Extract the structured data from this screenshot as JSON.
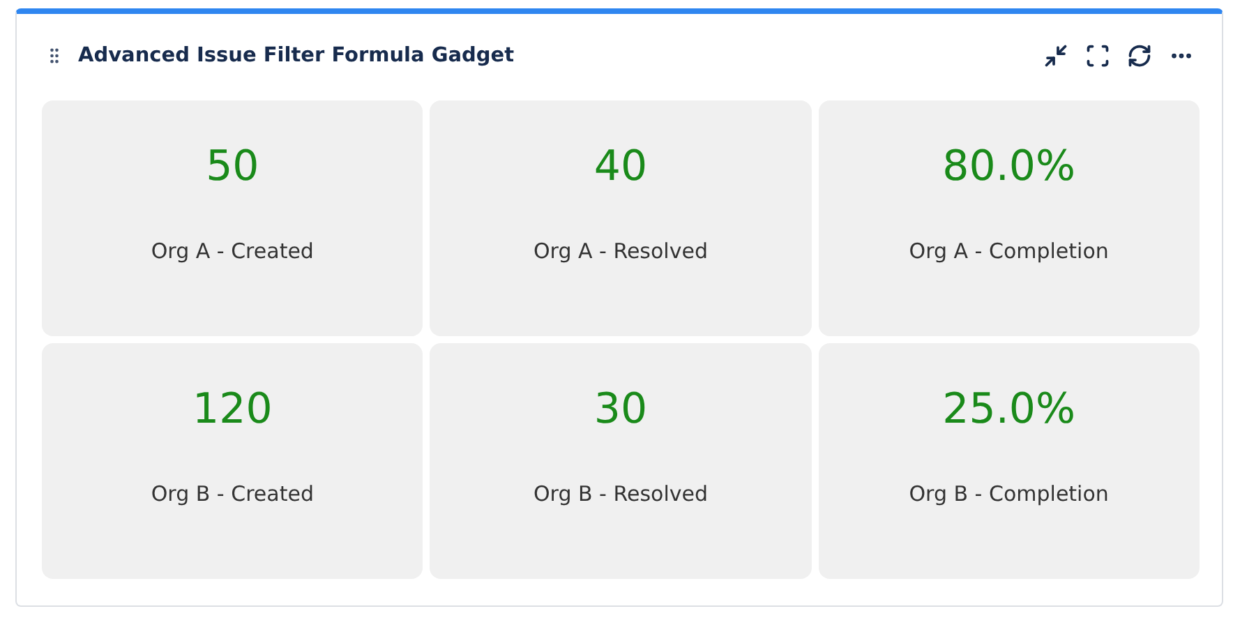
{
  "gadget": {
    "title": "Advanced Issue Filter Formula Gadget"
  },
  "tiles": [
    {
      "value": "50",
      "label": "Org A - Created"
    },
    {
      "value": "40",
      "label": "Org A - Resolved"
    },
    {
      "value": "80.0%",
      "label": "Org A - Completion"
    },
    {
      "value": "120",
      "label": "Org B - Created"
    },
    {
      "value": "30",
      "label": "Org B - Resolved"
    },
    {
      "value": "25.0%",
      "label": "Org B - Completion"
    }
  ]
}
